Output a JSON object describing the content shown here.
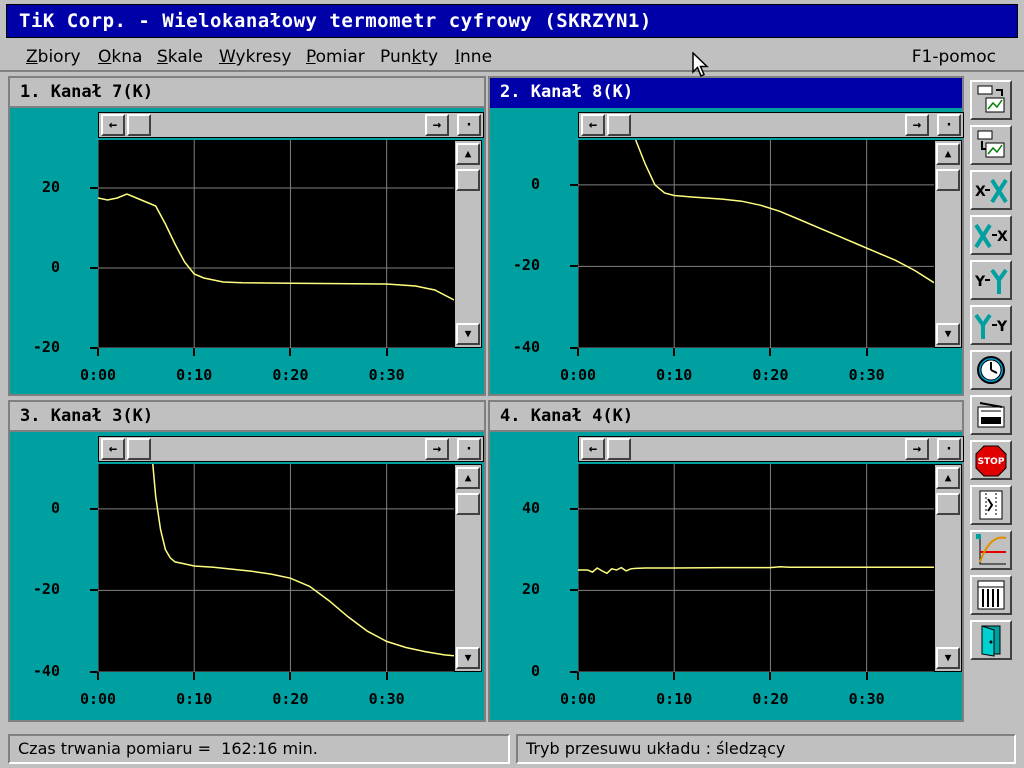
{
  "window": {
    "title": "TiK Corp. - Wielokanałowy termometr cyfrowy (SKRZYN1)"
  },
  "menu": {
    "items": [
      {
        "label": "Zbiory",
        "hotkey": "Z"
      },
      {
        "label": "Okna",
        "hotkey": "O"
      },
      {
        "label": "Skale",
        "hotkey": "S"
      },
      {
        "label": "Wykresy",
        "hotkey": "W"
      },
      {
        "label": "Pomiar",
        "hotkey": "P"
      },
      {
        "label": "Punkty",
        "hotkey": "k"
      },
      {
        "label": "Inne",
        "hotkey": "I"
      }
    ],
    "help": "F1-pomoc"
  },
  "panels": [
    {
      "title": "1. Kanał 7(K)",
      "active": false
    },
    {
      "title": "2. Kanał 8(K)",
      "active": true
    },
    {
      "title": "3. Kanał 3(K)",
      "active": false
    },
    {
      "title": "4. Kanał 4(K)",
      "active": false
    }
  ],
  "scroll_glyphs": {
    "left": "←",
    "right": "→",
    "corner": "·",
    "up": "▲",
    "down": "▼"
  },
  "chart_data": [
    {
      "type": "line",
      "title": "1. Kanał 7(K)",
      "x_unit": "min",
      "xlim": [
        0,
        37
      ],
      "xticks": [
        0,
        10,
        20,
        30
      ],
      "xtick_labels": [
        "0:00",
        "0:10",
        "0:20",
        "0:30"
      ],
      "ylim": [
        -20,
        32
      ],
      "yticks": [
        -20,
        0,
        20
      ],
      "ytick_labels": [
        "-20",
        "0",
        "20"
      ],
      "grid": true,
      "color": "#ffff80",
      "series": [
        {
          "x": [
            0,
            1,
            2,
            3,
            4,
            5,
            6,
            7,
            8,
            9,
            10,
            11,
            12,
            13,
            14,
            15,
            20,
            25,
            30,
            33,
            35,
            37
          ],
          "y": [
            17.5,
            17,
            17.5,
            18.5,
            17.5,
            16.5,
            15.5,
            11,
            6,
            1.5,
            -1.5,
            -2.5,
            -3,
            -3.5,
            -3.6,
            -3.7,
            -3.8,
            -3.9,
            -4,
            -4.5,
            -5.5,
            -8
          ]
        }
      ]
    },
    {
      "type": "line",
      "title": "2. Kanał 8(K)",
      "x_unit": "min",
      "xlim": [
        0,
        37
      ],
      "xticks": [
        0,
        10,
        20,
        30
      ],
      "xtick_labels": [
        "0:00",
        "0:10",
        "0:20",
        "0:30"
      ],
      "ylim": [
        -40,
        11
      ],
      "yticks": [
        -40,
        -20,
        0
      ],
      "ytick_labels": [
        "-40",
        "-20",
        "0"
      ],
      "grid": true,
      "color": "#ffff80",
      "series": [
        {
          "x": [
            6,
            7,
            8,
            9,
            10,
            12,
            15,
            17,
            19,
            21,
            23,
            25,
            27,
            29,
            31,
            33,
            35,
            37
          ],
          "y": [
            11,
            5,
            0,
            -2,
            -2.6,
            -3,
            -3.5,
            -4,
            -5,
            -6.5,
            -8.5,
            -10.5,
            -12.5,
            -14.5,
            -16.5,
            -18.5,
            -21,
            -24
          ]
        }
      ]
    },
    {
      "type": "line",
      "title": "3. Kanał 3(K)",
      "x_unit": "min",
      "xlim": [
        0,
        37
      ],
      "xticks": [
        0,
        10,
        20,
        30
      ],
      "xtick_labels": [
        "0:00",
        "0:10",
        "0:20",
        "0:30"
      ],
      "ylim": [
        -40,
        11
      ],
      "yticks": [
        -40,
        -20,
        0
      ],
      "ytick_labels": [
        "-40",
        "-20",
        "0"
      ],
      "grid": true,
      "color": "#ffff80",
      "series": [
        {
          "x": [
            5.7,
            6,
            6.5,
            7,
            7.5,
            8,
            9,
            10,
            12,
            14,
            16,
            18,
            20,
            22,
            24,
            26,
            28,
            30,
            32,
            34,
            36,
            37
          ],
          "y": [
            11,
            3,
            -5,
            -10,
            -12,
            -13,
            -13.5,
            -14,
            -14.3,
            -14.8,
            -15.3,
            -16,
            -17,
            -19,
            -22.5,
            -26.5,
            -30,
            -32.5,
            -34,
            -35,
            -35.8,
            -36
          ]
        }
      ]
    },
    {
      "type": "line",
      "title": "4. Kanał 4(K)",
      "x_unit": "min",
      "xlim": [
        0,
        37
      ],
      "xticks": [
        0,
        10,
        20,
        30
      ],
      "xtick_labels": [
        "0:00",
        "0:10",
        "0:20",
        "0:30"
      ],
      "ylim": [
        0,
        51
      ],
      "yticks": [
        0,
        20,
        40
      ],
      "ytick_labels": [
        "0",
        "20",
        "40"
      ],
      "grid": true,
      "color": "#ffff80",
      "series": [
        {
          "x": [
            0,
            1,
            1.5,
            2,
            2.5,
            3,
            3.5,
            4,
            4.5,
            5,
            5.5,
            6,
            7,
            10,
            15,
            20,
            21,
            22,
            25,
            30,
            35,
            37
          ],
          "y": [
            25,
            25,
            24.5,
            25.5,
            24.8,
            24.2,
            25.3,
            25,
            25.6,
            24.8,
            25.3,
            25.4,
            25.5,
            25.5,
            25.6,
            25.6,
            25.8,
            25.7,
            25.7,
            25.7,
            25.7,
            25.7
          ]
        }
      ]
    }
  ],
  "toolbar": {
    "tools": [
      {
        "name": "load-chart-icon"
      },
      {
        "name": "save-chart-icon"
      },
      {
        "name": "x-zoom-in-icon"
      },
      {
        "name": "x-zoom-out-icon"
      },
      {
        "name": "y-zoom-in-icon"
      },
      {
        "name": "y-zoom-out-icon"
      },
      {
        "name": "clock-icon"
      },
      {
        "name": "recorder-icon"
      },
      {
        "name": "stop-icon"
      },
      {
        "name": "points-icon"
      },
      {
        "name": "chart-scale-icon"
      },
      {
        "name": "table-icon"
      },
      {
        "name": "exit-door-icon"
      }
    ],
    "stop_label": "STOP"
  },
  "status": {
    "duration": "Czas trwania pomiaru =  162:16 min.",
    "mode": "Tryb przesuwu układu : śledzący"
  }
}
